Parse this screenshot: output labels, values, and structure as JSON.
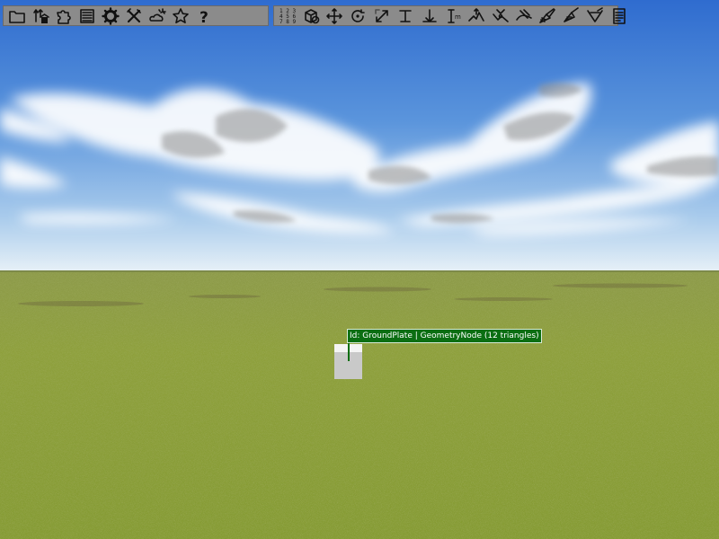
{
  "toolbar_main": {
    "buttons": [
      {
        "name": "open-folder-icon",
        "tooltip": "Open"
      },
      {
        "name": "trees-house-icon",
        "tooltip": "Add objects"
      },
      {
        "name": "puzzle-piece-icon",
        "tooltip": "Extensions"
      },
      {
        "name": "list-panel-icon",
        "tooltip": "Panels"
      },
      {
        "name": "gear-icon",
        "tooltip": "Settings"
      },
      {
        "name": "tools-icon",
        "tooltip": "Tools"
      },
      {
        "name": "weather-icon",
        "tooltip": "Weather"
      },
      {
        "name": "star-icon",
        "tooltip": "Favorites"
      },
      {
        "name": "help-icon",
        "tooltip": "Help",
        "glyph": "?"
      }
    ]
  },
  "toolbar_tools": {
    "buttons": [
      {
        "name": "number-grid-icon",
        "tooltip": "Numbers",
        "glyph": "123 456 789"
      },
      {
        "name": "select-object-icon"
      },
      {
        "name": "move-icon"
      },
      {
        "name": "rotate-icon"
      },
      {
        "name": "scale-icon"
      },
      {
        "name": "align-top-icon"
      },
      {
        "name": "anchor-icon"
      },
      {
        "name": "measure-icon",
        "glyph": "m"
      },
      {
        "name": "terrain-raise-icon"
      },
      {
        "name": "terrain-lower-icon"
      },
      {
        "name": "terrain-smooth-icon"
      },
      {
        "name": "paint-icon"
      },
      {
        "name": "paint-detail-icon"
      },
      {
        "name": "paint-erase-icon"
      },
      {
        "name": "notes-icon"
      }
    ]
  },
  "colors": {
    "sky_top": "#2f6ccf",
    "sky_horizon": "#e6f0f7",
    "grass": "#8a9c3a",
    "label_bg": "#0b6e12"
  },
  "selection_label": {
    "text": "Id: GroundPlate | GeometryNode (12 triangles)"
  }
}
